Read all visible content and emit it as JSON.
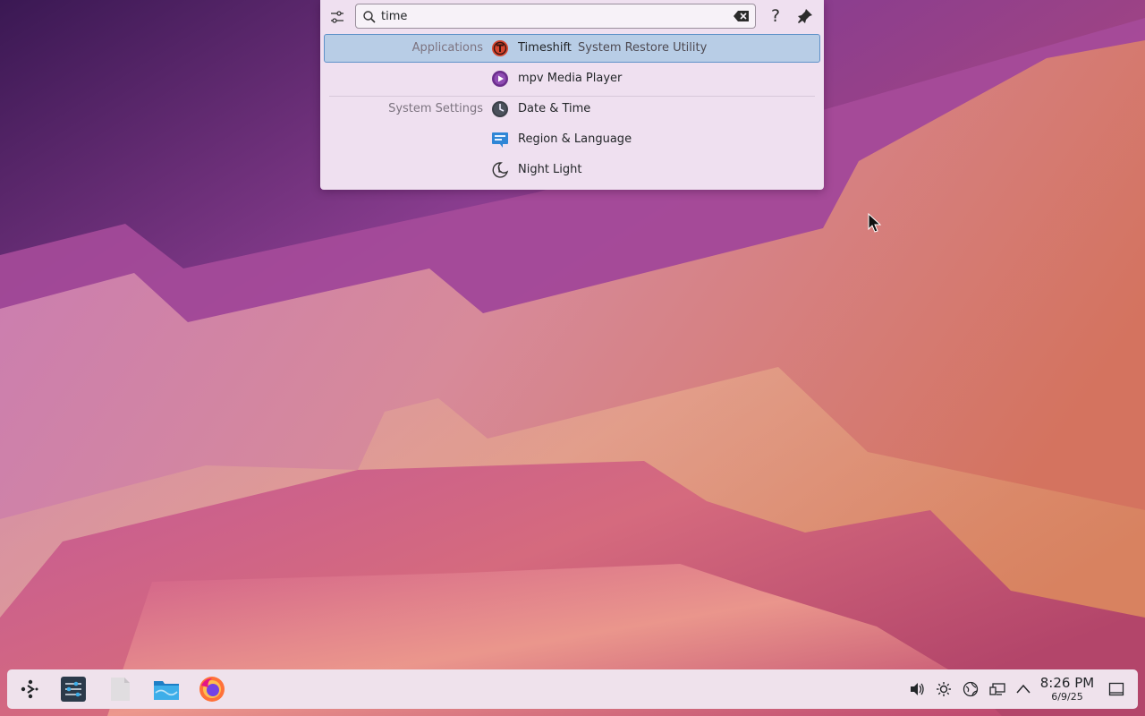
{
  "krunner": {
    "query": "time",
    "placeholder": "Search…",
    "help_glyph": "?",
    "results": [
      {
        "category": "Applications",
        "title": "Timeshift",
        "subtitle": "System Restore Utility",
        "icon": "timeshift-icon",
        "selected": true
      },
      {
        "category": "",
        "title": "mpv Media Player",
        "subtitle": "",
        "icon": "mpv-icon",
        "selected": false
      },
      {
        "category": "System Settings",
        "title": "Date & Time",
        "subtitle": "",
        "icon": "clock-icon",
        "selected": false
      },
      {
        "category": "",
        "title": "Region & Language",
        "subtitle": "",
        "icon": "region-language-icon",
        "selected": false
      },
      {
        "category": "",
        "title": "Night Light",
        "subtitle": "",
        "icon": "night-light-icon",
        "selected": false
      }
    ]
  },
  "taskbar": {
    "launchers": [
      "application-launcher-icon",
      "system-settings-icon",
      "text-document-icon",
      "file-manager-icon",
      "firefox-icon"
    ],
    "tray": [
      "volume-icon",
      "brightness-icon",
      "network-icon",
      "display-icon",
      "expand-tray-icon"
    ],
    "clock": {
      "time": "8:26 PM",
      "date": "6/9/25"
    }
  },
  "colors": {
    "selection": "#b8cde6",
    "selection_border": "#5f92c9",
    "panel_bg": "#efe0f0",
    "taskbar_bg": "#efe2ec"
  }
}
